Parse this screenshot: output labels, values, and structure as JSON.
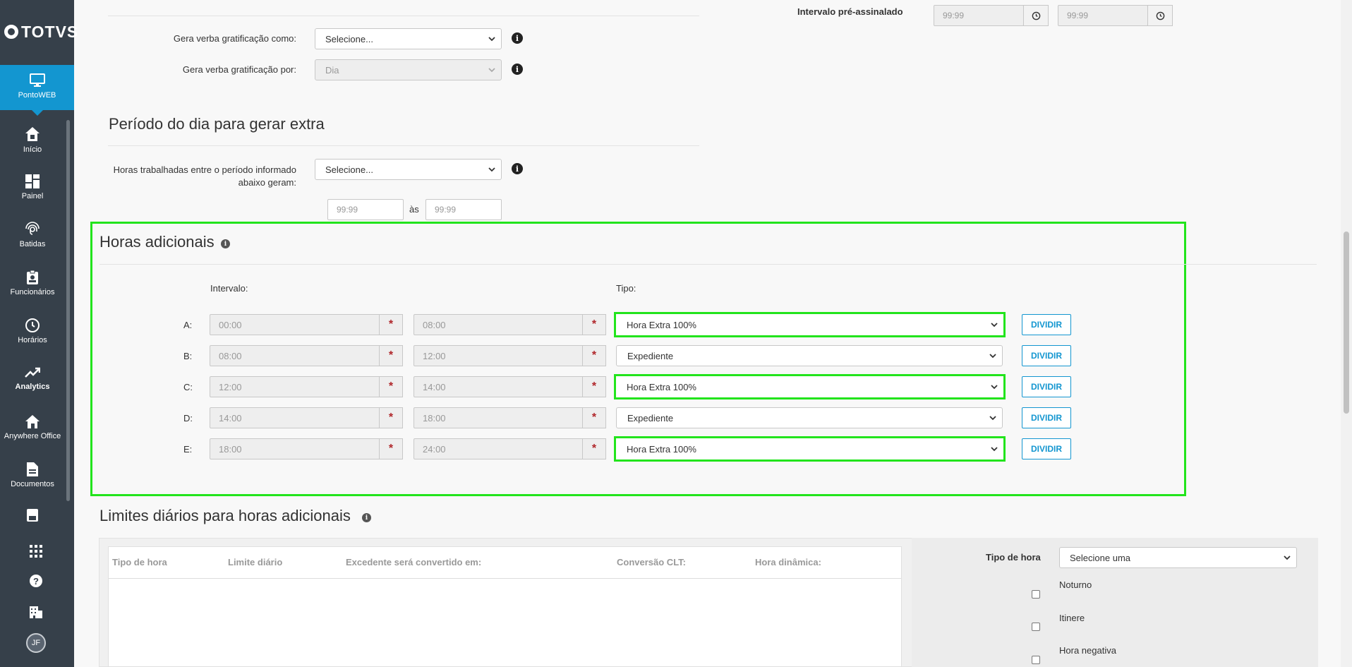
{
  "brand": "TOTVS",
  "sidebar": {
    "module": "PontoWEB",
    "items": [
      {
        "label": "Início",
        "icon": "home-icon"
      },
      {
        "label": "Painel",
        "icon": "dashboard-icon"
      },
      {
        "label": "Batidas",
        "icon": "fingerprint-icon"
      },
      {
        "label": "Funcionários",
        "icon": "badge-icon"
      },
      {
        "label": "Horários",
        "icon": "clock-icon"
      },
      {
        "label": "Analytics",
        "icon": "trend-icon"
      },
      {
        "label": "Anywhere Office",
        "icon": "house-icon"
      },
      {
        "label": "Documentos",
        "icon": "document-icon"
      }
    ],
    "avatar": "JF"
  },
  "gratificacao": {
    "como_label": "Gera verba gratificação como:",
    "como_value": "Selecione...",
    "por_label": "Gera verba gratificação por:",
    "por_value": "Dia"
  },
  "pre_assinalado": {
    "label": "Intervalo pré-assinalado",
    "start_placeholder": "99:99",
    "end_placeholder": "99:99"
  },
  "periodo": {
    "title": "Período do dia para gerar extra",
    "label": "Horas trabalhadas entre o período informado abaixo geram:",
    "value": "Selecione...",
    "start_placeholder": "99:99",
    "separator": "às",
    "end_placeholder": "99:99"
  },
  "horas_adicionais": {
    "title": "Horas adicionais",
    "intervalo_label": "Intervalo:",
    "tipo_label": "Tipo:",
    "button_label": "DIVIDIR",
    "rows": [
      {
        "letter": "A:",
        "start": "00:00",
        "end": "08:00",
        "tipo": "Hora Extra 100%"
      },
      {
        "letter": "B:",
        "start": "08:00",
        "end": "12:00",
        "tipo": "Expediente"
      },
      {
        "letter": "C:",
        "start": "12:00",
        "end": "14:00",
        "tipo": "Hora Extra 100%"
      },
      {
        "letter": "D:",
        "start": "14:00",
        "end": "18:00",
        "tipo": "Expediente"
      },
      {
        "letter": "E:",
        "start": "18:00",
        "end": "24:00",
        "tipo": "Hora Extra 100%"
      }
    ]
  },
  "limites": {
    "title": "Limites diários para horas adicionais",
    "columns": [
      "Tipo de hora",
      "Limite diário",
      "Excedente será convertido em:",
      "Conversão CLT:",
      "Hora dinâmica:"
    ],
    "tipo_hora_label": "Tipo de hora",
    "tipo_hora_value": "Selecione uma",
    "checkboxes": [
      "Noturno",
      "Itinere",
      "Hora negativa"
    ]
  },
  "colors": {
    "sidebar": "#36404a",
    "accent": "#1396d0",
    "highlight": "#22e41c",
    "required": "#b0262a"
  }
}
